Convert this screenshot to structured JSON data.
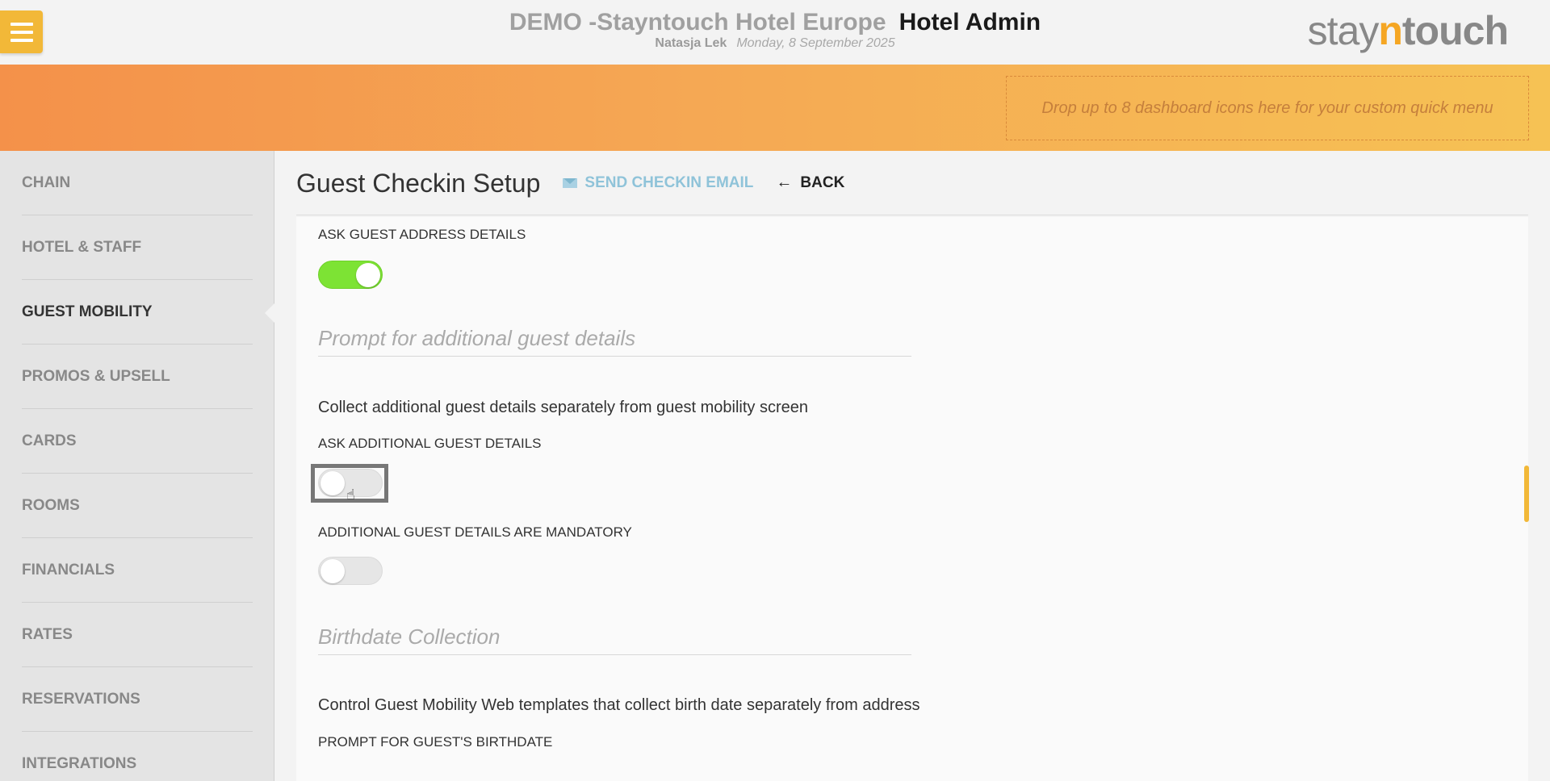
{
  "header": {
    "hotel_name": "DEMO -Stayntouch Hotel Europe",
    "app_name": "Hotel Admin",
    "user": "Natasja Lek",
    "date": "Monday, 8 September 2025",
    "logo": {
      "part1": "stay",
      "part2": "n",
      "part3": "touch"
    }
  },
  "banner": {
    "dropzone_text": "Drop up to 8 dashboard icons here for your custom quick menu"
  },
  "sidebar": {
    "items": [
      {
        "label": "CHAIN"
      },
      {
        "label": "HOTEL & STAFF"
      },
      {
        "label": "GUEST MOBILITY",
        "active": true
      },
      {
        "label": "PROMOS & UPSELL"
      },
      {
        "label": "CARDS"
      },
      {
        "label": "ROOMS"
      },
      {
        "label": "FINANCIALS"
      },
      {
        "label": "RATES"
      },
      {
        "label": "RESERVATIONS"
      },
      {
        "label": "INTEGRATIONS"
      }
    ]
  },
  "page": {
    "title": "Guest Checkin Setup",
    "send_email_label": "SEND CHECKIN EMAIL",
    "back_label": "BACK"
  },
  "settings": {
    "ask_address_label": "ASK GUEST ADDRESS DETAILS",
    "ask_address_on": true,
    "additional_section_title": "Prompt for additional guest details",
    "additional_desc": "Collect additional guest details separately from guest mobility screen",
    "ask_additional_label": "ASK ADDITIONAL GUEST DETAILS",
    "ask_additional_on": false,
    "mandatory_label": "ADDITIONAL GUEST DETAILS ARE MANDATORY",
    "mandatory_on": false,
    "birthdate_section_title": "Birthdate Collection",
    "birthdate_desc": "Control Guest Mobility Web templates that collect birth date separately from address",
    "prompt_birthdate_label": "PROMPT FOR GUEST'S BIRTHDATE"
  },
  "colors": {
    "accent": "#f2b838",
    "toggle_on": "#7de334",
    "link": "#8fc3d9"
  }
}
